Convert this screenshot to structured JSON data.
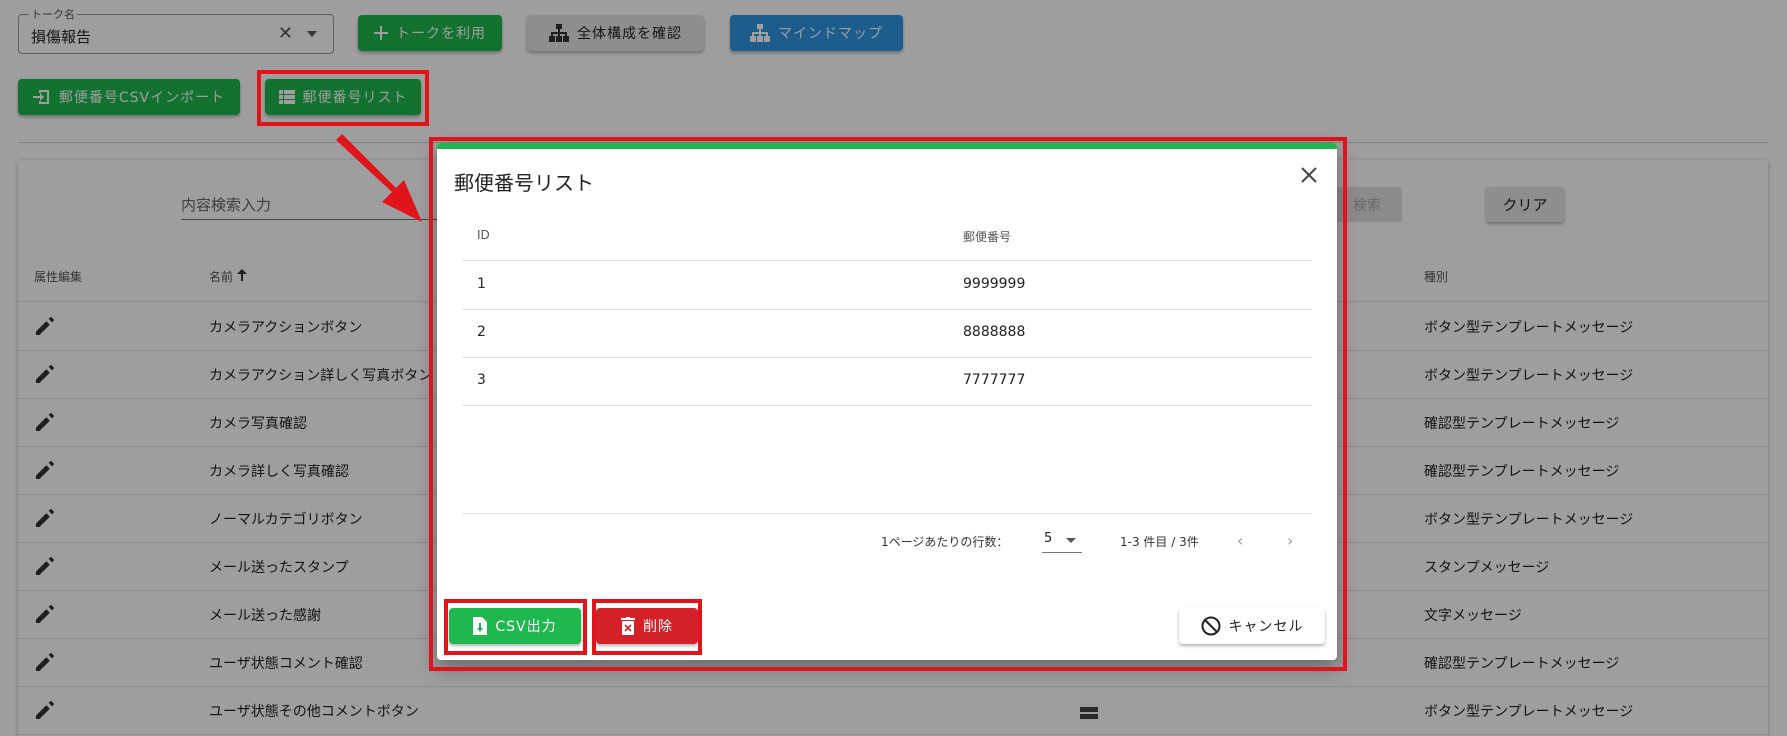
{
  "talk_field": {
    "legend": "トーク名",
    "value": "損傷報告"
  },
  "top_buttons": {
    "use_talk": "トークを利用",
    "check_structure": "全体構成を確認",
    "mind_map": "マインドマップ"
  },
  "second_buttons": {
    "csv_import": "郵便番号CSVインポート",
    "zip_list": "郵便番号リスト"
  },
  "search": {
    "placeholder": "内容検索入力",
    "search_label": "検索",
    "clear_label": "クリア"
  },
  "bg_table": {
    "headers": {
      "edit": "属性編集",
      "name": "名前",
      "type": "種別"
    },
    "rows": [
      {
        "name": "カメラアクションボタン",
        "type": "ボタン型テンプレートメッセージ"
      },
      {
        "name": "カメラアクション詳しく写真ボタン",
        "type": "ボタン型テンプレートメッセージ"
      },
      {
        "name": "カメラ写真確認",
        "type": "確認型テンプレートメッセージ"
      },
      {
        "name": "カメラ詳しく写真確認",
        "type": "確認型テンプレートメッセージ"
      },
      {
        "name": "ノーマルカテゴリボタン",
        "type": "ボタン型テンプレートメッセージ"
      },
      {
        "name": "メール送ったスタンプ",
        "type": "スタンプメッセージ"
      },
      {
        "name": "メール送った感謝",
        "type": "文字メッセージ"
      },
      {
        "name": "ユーザ状態コメント確認",
        "type": "確認型テンプレートメッセージ"
      },
      {
        "name": "ユーザ状態その他コメントボタン",
        "type": "ボタン型テンプレートメッセージ"
      }
    ]
  },
  "dialog": {
    "title": "郵便番号リスト",
    "columns": {
      "id": "ID",
      "zip": "郵便番号"
    },
    "rows": [
      {
        "id": "1",
        "zip": "9999999"
      },
      {
        "id": "2",
        "zip": "8888888"
      },
      {
        "id": "3",
        "zip": "7777777"
      }
    ],
    "pagination": {
      "rows_per_page_label": "1ページあたりの行数：",
      "rows_per_page_value": "5",
      "range": "1-3 件目 / 3件"
    },
    "buttons": {
      "csv_export": "CSV出力",
      "delete": "削除",
      "cancel": "キャンセル"
    }
  },
  "colors": {
    "green": "#1fb84e",
    "red": "#d32127",
    "blue": "#2e97e6",
    "highlight": "#e0141a"
  }
}
